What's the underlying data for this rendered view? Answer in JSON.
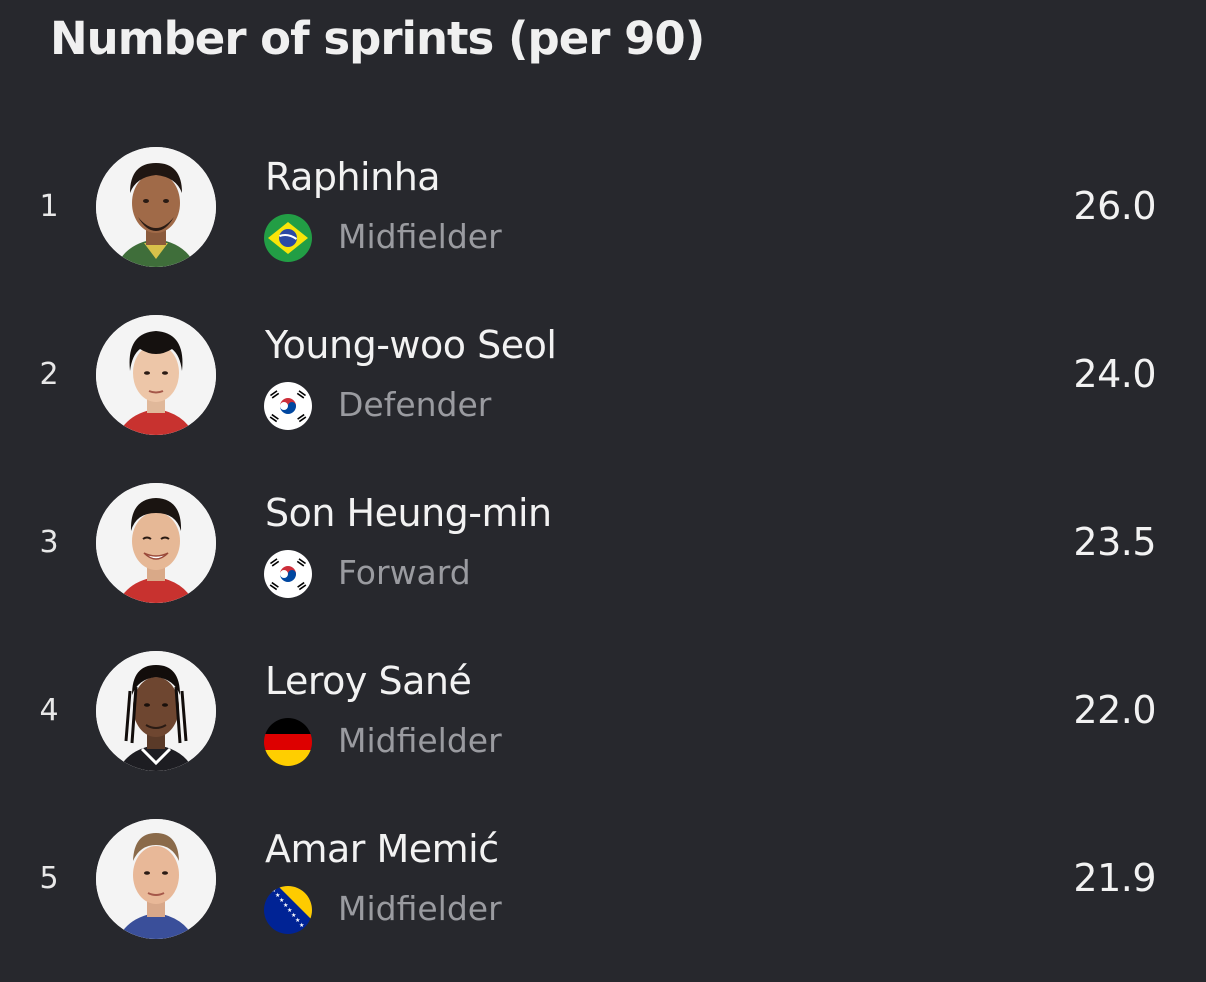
{
  "title": "Number of sprints (per 90)",
  "players": [
    {
      "rank": "1",
      "name": "Raphinha",
      "position": "Midfielder",
      "value": "26.0",
      "flag": "brazil-flag-icon",
      "avatar": "raphinha-avatar"
    },
    {
      "rank": "2",
      "name": "Young-woo Seol",
      "position": "Defender",
      "value": "24.0",
      "flag": "south-korea-flag-icon",
      "avatar": "young-woo-seol-avatar"
    },
    {
      "rank": "3",
      "name": "Son Heung-min",
      "position": "Forward",
      "value": "23.5",
      "flag": "south-korea-flag-icon",
      "avatar": "son-heung-min-avatar"
    },
    {
      "rank": "4",
      "name": "Leroy Sané",
      "position": "Midfielder",
      "value": "22.0",
      "flag": "germany-flag-icon",
      "avatar": "leroy-sane-avatar"
    },
    {
      "rank": "5",
      "name": "Amar Memić",
      "position": "Midfielder",
      "value": "21.9",
      "flag": "bosnia-flag-icon",
      "avatar": "amar-memic-avatar"
    }
  ],
  "colors": {
    "background": "#27282d",
    "text_primary": "#f2f2f2",
    "text_secondary": "#9a9ba0",
    "avatar_background": "#f4f4f4"
  }
}
